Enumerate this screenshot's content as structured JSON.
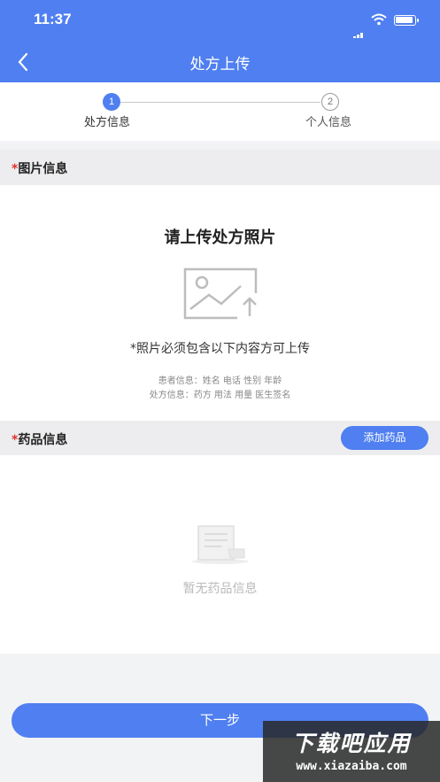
{
  "status_bar": {
    "time": "11:37"
  },
  "nav": {
    "title": "处方上传"
  },
  "steps": [
    {
      "number": "1",
      "label": "处方信息"
    },
    {
      "number": "2",
      "label": "个人信息"
    }
  ],
  "photo_section": {
    "required_mark": "*",
    "title": "图片信息",
    "heading": "请上传处方照片",
    "required_note": "*照片必须包含以下内容方可上传",
    "hints": [
      "患者信息：姓名 电话 性别 年龄",
      "处方信息：药方 用法 用量 医生签名"
    ]
  },
  "medicine_section": {
    "required_mark": "*",
    "title": "药品信息",
    "add_button": "添加药品",
    "empty_text": "暂无药品信息"
  },
  "footer": {
    "next_button": "下一步"
  },
  "watermark": {
    "main": "下载吧应用",
    "url": "www.xiazaiba.com"
  },
  "colors": {
    "primary": "#4f7ff0",
    "required": "#e2322a",
    "background": "#f2f3f5"
  }
}
